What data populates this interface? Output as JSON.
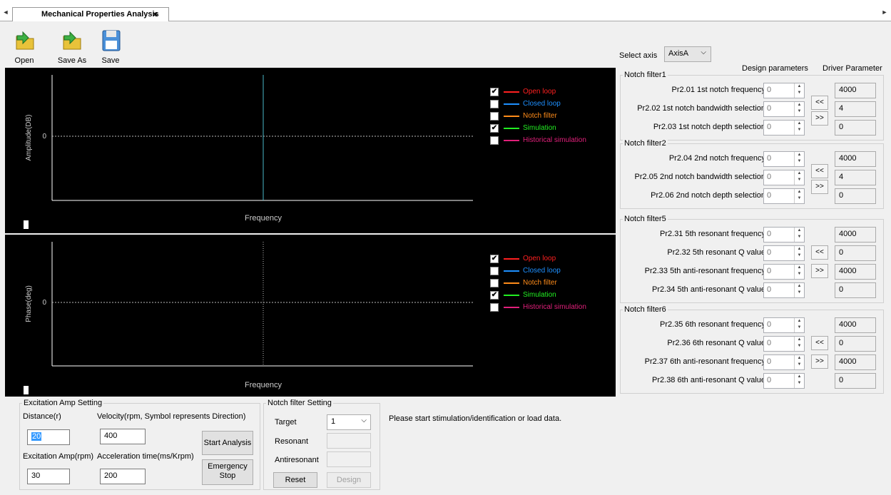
{
  "tab": {
    "title": "Mechanical Properties Analysis",
    "close": "×",
    "left_arrow": "◄",
    "right_arrow": "►"
  },
  "toolbar": {
    "open_label": "Open",
    "save_as_label": "Save As",
    "save_label": "Save"
  },
  "colors": {
    "open_loop": "#ff2020",
    "closed_loop": "#1e90ff",
    "notch_filter": "#ff8c1a",
    "simulation": "#22ee22",
    "historical_simulation": "#e0207a"
  },
  "amplitude_plot": {
    "ylabel": "Amplitude(DB)",
    "xlabel": "Frequency",
    "zero_tick": "0",
    "legend": [
      {
        "label": "Open loop",
        "checked": true,
        "color_key": "open_loop",
        "check": "✔"
      },
      {
        "label": "Closed loop",
        "checked": false,
        "color_key": "closed_loop",
        "check": ""
      },
      {
        "label": "Notch filter",
        "checked": false,
        "color_key": "notch_filter",
        "check": ""
      },
      {
        "label": "Simulation",
        "checked": true,
        "color_key": "simulation",
        "check": "✔"
      },
      {
        "label": "Historical simulation",
        "checked": false,
        "color_key": "historical_simulation",
        "check": ""
      }
    ]
  },
  "phase_plot": {
    "ylabel": "Phase(deg)",
    "xlabel": "Frequency",
    "zero_tick": "0",
    "legend": [
      {
        "label": "Open loop",
        "checked": true,
        "check": "✔"
      },
      {
        "label": "Closed loop",
        "checked": false,
        "check": ""
      },
      {
        "label": "Notch filter",
        "checked": false,
        "check": ""
      },
      {
        "label": "Simulation",
        "checked": true,
        "check": "✔"
      },
      {
        "label": "Historical simulation",
        "checked": false,
        "check": ""
      }
    ]
  },
  "axis_select": {
    "label": "Select axis",
    "value": "AxisA"
  },
  "headers": {
    "design": "Design parameters",
    "driver": "Driver Parameter"
  },
  "notch_filters": [
    {
      "title": "Notch filter1",
      "params": [
        {
          "label": "Pr2.01 1st notch frequency",
          "design": "0",
          "driver": "4000"
        },
        {
          "label": "Pr2.02 1st notch bandwidth selection",
          "design": "0",
          "driver": "4"
        },
        {
          "label": "Pr2.03 1st notch depth selection",
          "design": "0",
          "driver": "0"
        }
      ]
    },
    {
      "title": "Notch filter2",
      "params": [
        {
          "label": "Pr2.04 2nd notch frequency",
          "design": "0",
          "driver": "4000"
        },
        {
          "label": "Pr2.05 2nd notch bandwidth selection",
          "design": "0",
          "driver": "4"
        },
        {
          "label": "Pr2.06 2nd notch depth selection",
          "design": "0",
          "driver": "0"
        }
      ]
    },
    {
      "title": "Notch filter5",
      "params": [
        {
          "label": "Pr2.31 5th resonant frequency",
          "design": "0",
          "driver": "4000"
        },
        {
          "label": "Pr2.32 5th resonant Q value",
          "design": "0",
          "driver": "0"
        },
        {
          "label": "Pr2.33 5th anti-resonant frequency",
          "design": "0",
          "driver": "4000"
        },
        {
          "label": "Pr2.34 5th anti-resonant Q value",
          "design": "0",
          "driver": "0"
        }
      ]
    },
    {
      "title": "Notch filter6",
      "params": [
        {
          "label": "Pr2.35 6th resonant frequency",
          "design": "0",
          "driver": "4000"
        },
        {
          "label": "Pr2.36 6th resonant Q value",
          "design": "0",
          "driver": "0"
        },
        {
          "label": "Pr2.37 6th anti-resonant frequency",
          "design": "0",
          "driver": "4000"
        },
        {
          "label": "Pr2.38 6th anti-resonant Q value",
          "design": "0",
          "driver": "0"
        }
      ]
    }
  ],
  "arrows": {
    "left": "<<",
    "right": ">>"
  },
  "excitation": {
    "title": "Excitation Amp Setting",
    "distance_label": "Distance(r)",
    "distance_value": "20",
    "velocity_label": "Velocity(rpm, Symbol represents Direction)",
    "velocity_value": "400",
    "amp_label": "Excitation Amp(rpm)",
    "amp_value": "30",
    "accel_label": "Acceleration time(ms/Krpm)",
    "accel_value": "200",
    "start_label": "Start Analysis",
    "stop_label": "Emergency Stop"
  },
  "notch_setting": {
    "title": "Notch filter Setting",
    "target_label": "Target",
    "target_value": "1",
    "resonant_label": "Resonant",
    "antiresonant_label": "Antiresonant",
    "reset_label": "Reset",
    "design_label": "Design"
  },
  "status_message": "Please start stimulation/identification or load data."
}
